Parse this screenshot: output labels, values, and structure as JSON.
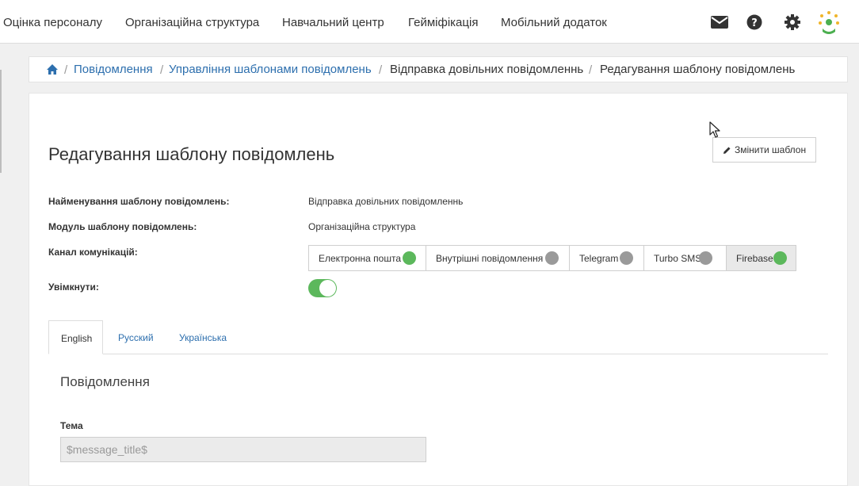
{
  "nav": {
    "items": [
      "Оцінка персоналу",
      "Організаційна структура",
      "Навчальний центр",
      "Геймiфiкацiя",
      "Мобільний додаток"
    ],
    "icons": [
      "envelope-icon",
      "question-icon",
      "gear-icon",
      "logo-icon"
    ]
  },
  "breadcrumb": {
    "items": [
      "Повідомлення",
      "Управління шаблонами повідомлень",
      "Відправка довільних повідомленнь",
      "Редагування шаблону повідомлень"
    ]
  },
  "page": {
    "title": "Редагування шаблону повідомлень",
    "edit_button": "Змінити шаблон"
  },
  "details": {
    "name_label": "Найменування шаблону повідомлень:",
    "name_value": "Відправка довільних повідомленнь",
    "module_label": "Модуль шаблону повідомлень:",
    "module_value": "Організаційна структура",
    "channel_label": "Канал комунікацій:",
    "enabled_label": "Увімкнути:",
    "enabled": true
  },
  "channels": [
    {
      "label": "Електронна пошта",
      "on": true
    },
    {
      "label": "Внутрішні повідомлення",
      "on": false
    },
    {
      "label": "Telegram",
      "on": false
    },
    {
      "label": "Turbo SMS",
      "on": false
    },
    {
      "label": "Firebase",
      "on": true,
      "selected": true
    }
  ],
  "tabs": [
    "English",
    "Русский",
    "Українська"
  ],
  "active_tab": "English",
  "message": {
    "section_title": "Повідомлення",
    "subject_label": "Тема",
    "subject_value": "$message_title$"
  },
  "colors": {
    "link": "#2d6fae",
    "green": "#5cb85c",
    "gray": "#9a9a9a"
  }
}
